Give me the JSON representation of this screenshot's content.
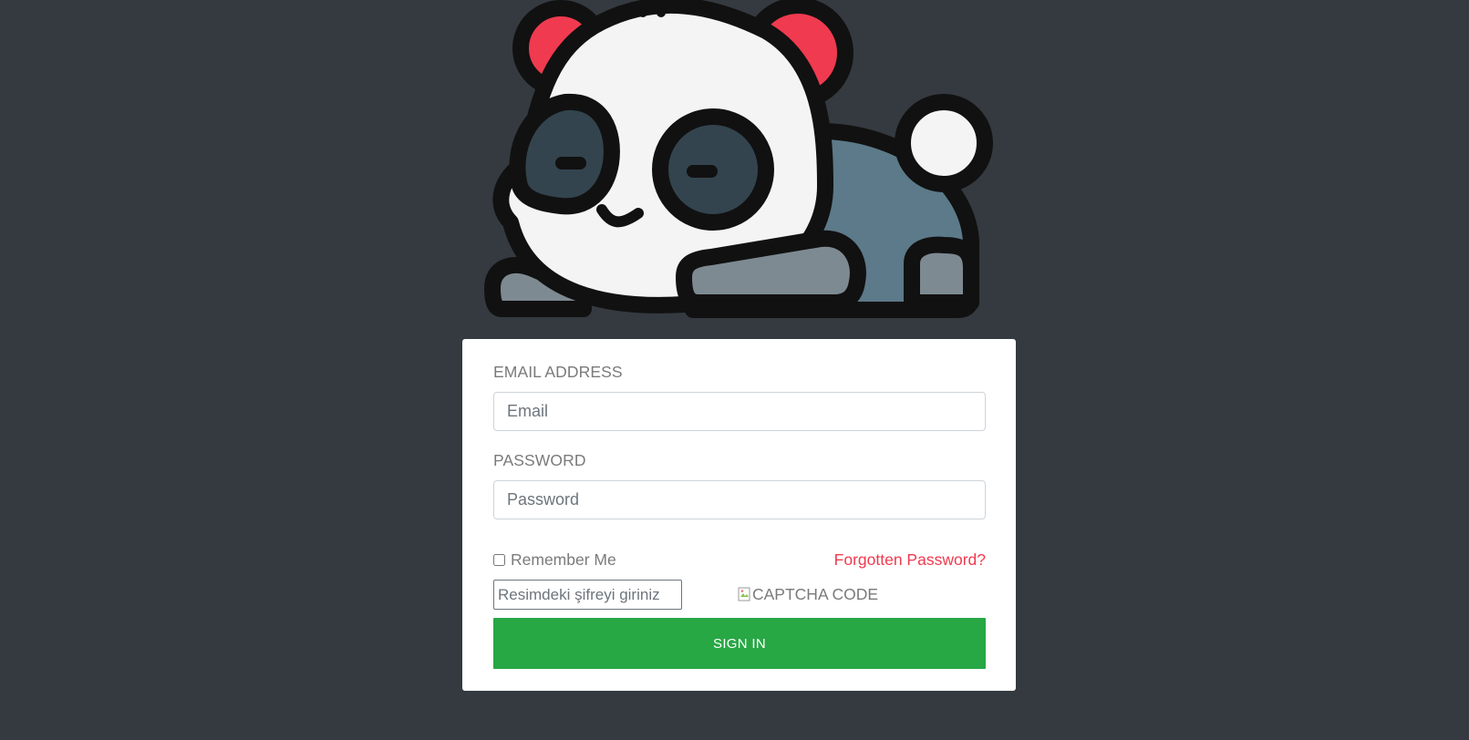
{
  "mascot": {
    "icon": "panda-icon",
    "colors": {
      "outline": "#111111",
      "face": "#f4f4f4",
      "ear_inner": "#f03a4f",
      "eye_patch": "#33444e",
      "body": "#5c7a89",
      "paw": "#7e8a92"
    }
  },
  "form": {
    "email_label": "EMAIL ADDRESS",
    "email_placeholder": "Email",
    "email_value": "",
    "password_label": "PASSWORD",
    "password_placeholder": "Password",
    "password_value": "",
    "remember_label": "Remember Me",
    "remember_checked": false,
    "forgot_label": "Forgotten Password?",
    "captcha_placeholder": "Resimdeki şifreyi giriniz",
    "captcha_alt": "CAPTCHA CODE",
    "signin_label": "SIGN IN"
  },
  "colors": {
    "background": "#343a40",
    "card": "#ffffff",
    "primary_button": "#28a745",
    "link": "#f03a4f",
    "label": "#7a7a7a"
  }
}
